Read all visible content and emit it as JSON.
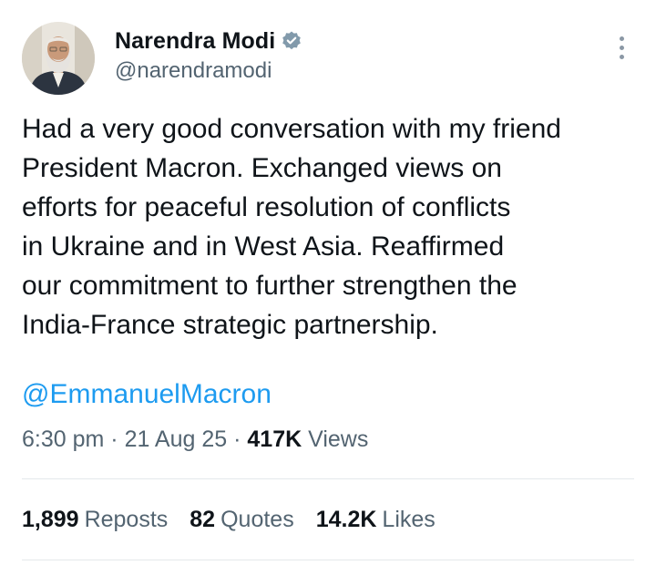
{
  "author": {
    "display_name": "Narendra Modi",
    "handle": "@narendramodi",
    "verified_badge": "verified-check-icon",
    "avatar": "profile-photo"
  },
  "tweet": {
    "text": "Had a very good conversation with my friend\nPresident Macron. Exchanged views on\nefforts for peaceful resolution of conflicts\nin Ukraine and in West Asia. Reaffirmed\nour commitment to further strengthen the\nIndia-France strategic partnership.",
    "mention": "@EmmanuelMacron"
  },
  "meta": {
    "time": "6:30 pm",
    "sep1": " · ",
    "date": "21 Aug 25",
    "sep2": " · ",
    "views_count": "417K",
    "views_label": "Views"
  },
  "stats": {
    "reposts_count": "1,899",
    "reposts_label": "Reposts",
    "quotes_count": "82",
    "quotes_label": "Quotes",
    "likes_count": "14.2K",
    "likes_label": "Likes"
  },
  "colors": {
    "link": "#1d9bf0",
    "verified": "#829aab",
    "secondary_text": "#536471",
    "primary_text": "#0f1419"
  },
  "icons": {
    "more": "more-vertical-icon"
  }
}
